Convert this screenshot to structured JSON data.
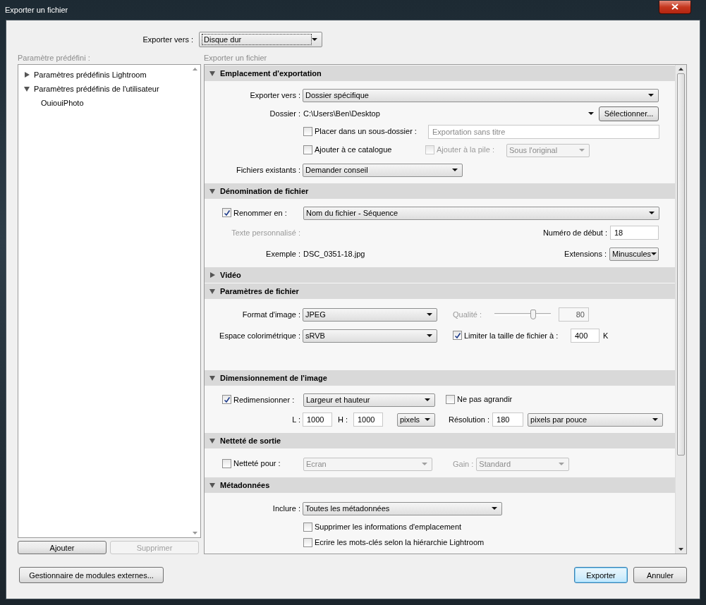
{
  "window": {
    "title": "Exporter un fichier"
  },
  "export_to": {
    "label": "Exporter vers :",
    "value": "Disque dur"
  },
  "presets": {
    "label": "Paramètre prédéfini :",
    "items": [
      {
        "label": "Paramètres prédéfinis Lightroom",
        "expanded": false
      },
      {
        "label": "Paramètres prédéfinis de l'utilisateur",
        "expanded": true,
        "children": [
          {
            "label": "OuiouiPhoto"
          }
        ]
      }
    ]
  },
  "preset_buttons": [
    {
      "label": "Ajouter",
      "disabled": false
    },
    {
      "label": "Supprimer",
      "disabled": true
    }
  ],
  "panel_title": "Exporter un fichier",
  "sections": [
    {
      "kind": "location",
      "title": "Emplacement d'exportation",
      "expanded": true,
      "export_to": {
        "label": "Exporter vers :",
        "value": "Dossier spécifique"
      },
      "folder": {
        "label": "Dossier :",
        "value": "C:\\Users\\Ben\\Desktop",
        "button": "Sélectionner..."
      },
      "subfolder": {
        "label": "Placer dans un sous-dossier :",
        "checked": false,
        "placeholder": "Exportation sans titre"
      },
      "add_catalog": {
        "label": "Ajouter à ce catalogue",
        "checked": false
      },
      "add_stack": {
        "label": "Ajouter à la pile :",
        "checked": false,
        "disabled": true,
        "value": "Sous l'original"
      },
      "existing": {
        "label": "Fichiers existants :",
        "value": "Demander conseil"
      }
    },
    {
      "kind": "naming",
      "title": "Dénomination de fichier",
      "expanded": true,
      "rename": {
        "label": "Renommer en :",
        "checked": true,
        "value": "Nom du fichier - Séquence"
      },
      "custom_text": {
        "label": "Texte personnalisé :",
        "disabled": true
      },
      "start_number": {
        "label": "Numéro de début :",
        "value": "18"
      },
      "example": {
        "label": "Exemple :",
        "value": "DSC_0351-18.jpg"
      },
      "extensions": {
        "label": "Extensions :",
        "value": "Minuscules"
      }
    },
    {
      "kind": "video",
      "title": "Vidéo",
      "expanded": false
    },
    {
      "kind": "file_settings",
      "title": "Paramètres de fichier",
      "expanded": true,
      "format": {
        "label": "Format d'image :",
        "value": "JPEG"
      },
      "quality": {
        "label": "Qualité :",
        "disabled": true,
        "level": 0.67,
        "value": "80"
      },
      "color_space": {
        "label": "Espace colorimétrique :",
        "value": "sRVB"
      },
      "limit": {
        "label": "Limiter la taille de fichier à :",
        "checked": true,
        "value": "400",
        "unit": "K"
      }
    },
    {
      "kind": "sizing",
      "title": "Dimensionnement de l'image",
      "expanded": true,
      "resize": {
        "label": "Redimensionner :",
        "checked": true,
        "value": "Largeur et hauteur"
      },
      "no_enlarge": {
        "label": "Ne pas agrandir",
        "checked": false
      },
      "width": {
        "label": "L :",
        "value": "1000"
      },
      "height": {
        "label": "H :",
        "value": "1000"
      },
      "unit": {
        "value": "pixels"
      },
      "resolution": {
        "label": "Résolution :",
        "value": "180",
        "unit": "pixels par pouce"
      }
    },
    {
      "kind": "sharpening",
      "title": "Netteté de sortie",
      "expanded": true,
      "sharpen": {
        "label": "Netteté pour :",
        "checked": false,
        "value": "Ecran"
      },
      "gain": {
        "label": "Gain :",
        "disabled": true,
        "value": "Standard"
      }
    },
    {
      "kind": "metadata",
      "title": "Métadonnées",
      "expanded": true,
      "include": {
        "label": "Inclure :",
        "value": "Toutes les métadonnées"
      },
      "options": [
        {
          "label": "Supprimer les informations d'emplacement",
          "checked": false
        },
        {
          "label": "Ecrire les mots-clés selon la hiérarchie Lightroom",
          "checked": false
        }
      ]
    }
  ],
  "plugin_button": "Gestionnaire de modules externes...",
  "actions": [
    {
      "label": "Exporter",
      "focused": true
    },
    {
      "label": "Annuler",
      "focused": false
    }
  ]
}
